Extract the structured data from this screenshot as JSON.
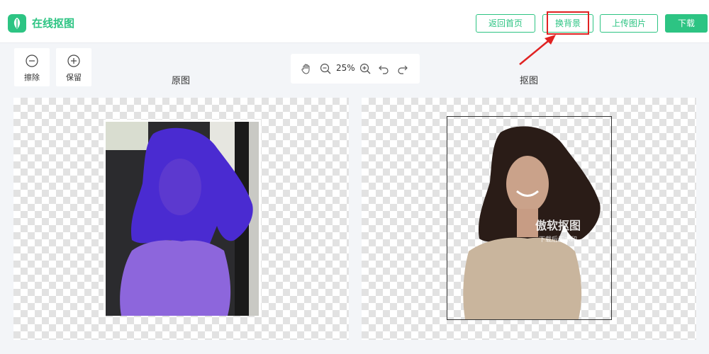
{
  "header": {
    "app_title": "在线抠图",
    "logo_icon": "leaf-logo-icon",
    "buttons": {
      "home": "返回首页",
      "change_bg": "换背景",
      "upload": "上传图片",
      "download": "下载"
    }
  },
  "toolbar": {
    "erase_label": "擦除",
    "keep_label": "保留",
    "zoom_value": "25%",
    "icons": [
      "hand-icon",
      "zoom-out-icon",
      "zoom-in-icon",
      "undo-icon",
      "redo-icon"
    ]
  },
  "panels": {
    "original_title": "原图",
    "cutout_title": "抠图"
  },
  "watermark": {
    "main": "傲软抠图",
    "sub": "下载后无水印"
  },
  "colors": {
    "accent": "#2dc483",
    "highlight": "#e02222",
    "mask": "#4a2bd1"
  }
}
